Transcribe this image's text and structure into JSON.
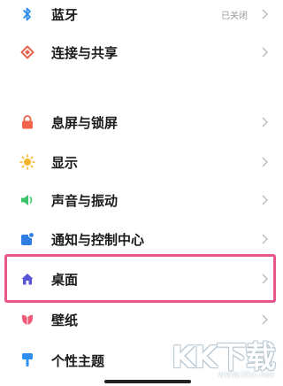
{
  "settings": {
    "items": [
      {
        "label": "蓝牙",
        "value": "已关闭",
        "icon": "bluetooth-icon"
      },
      {
        "label": "连接与共享",
        "icon": "connection-share-icon"
      },
      {
        "label": "息屏与锁屏",
        "icon": "lock-screen-icon"
      },
      {
        "label": "显示",
        "icon": "display-sun-icon"
      },
      {
        "label": "声音与振动",
        "icon": "speaker-icon"
      },
      {
        "label": "通知与控制中心",
        "icon": "notification-icon"
      },
      {
        "label": "桌面",
        "icon": "home-icon"
      },
      {
        "label": "壁纸",
        "icon": "wallpaper-tulip-icon"
      },
      {
        "label": "个性主题",
        "icon": "theme-brush-icon"
      }
    ]
  },
  "colors": {
    "highlight_border": "#e8578c",
    "bluetooth": "#2d8cf0",
    "connection": "#e8664f",
    "lock": "#f0644b",
    "display": "#f5b52b",
    "sound": "#3cc46a",
    "notification": "#2f7de1",
    "home": "#5a55d6",
    "wallpaper": "#ee5a78",
    "theme": "#2e8ff0"
  },
  "watermark": {
    "main": "KK下载",
    "sub": "www.kkx.net"
  }
}
